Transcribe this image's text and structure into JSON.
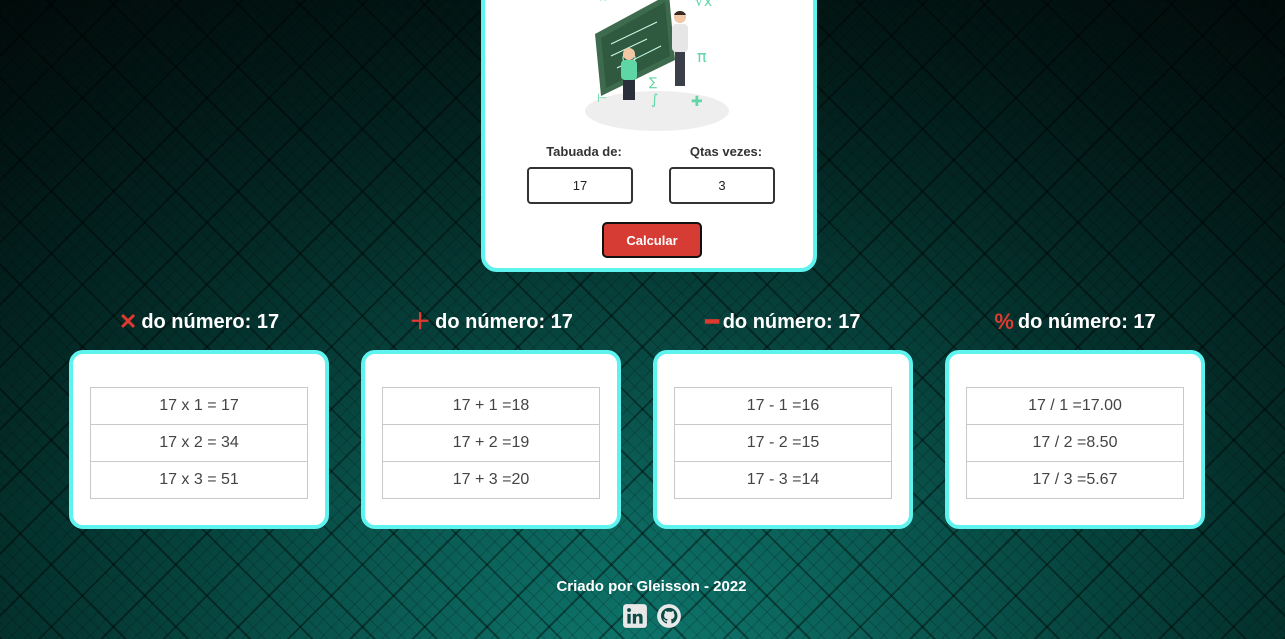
{
  "form": {
    "tabuada_label": "Tabuada de:",
    "vezes_label": "Qtas vezes:",
    "tabuada_value": "17",
    "vezes_value": "3",
    "calc_label": "Calcular"
  },
  "sections": [
    {
      "icon": "times-icon",
      "title": "do número: 17",
      "rows": [
        "17 x 1 = 17",
        "17 x 2 = 34",
        "17 x 3 = 51"
      ]
    },
    {
      "icon": "plus-icon",
      "title": "do número: 17",
      "rows": [
        "17 + 1 =18",
        "17 + 2 =19",
        "17 + 3 =20"
      ]
    },
    {
      "icon": "minus-icon",
      "title": "do número: 17",
      "rows": [
        "17 - 1 =16",
        "17 - 2 =15",
        "17 - 3 =14"
      ]
    },
    {
      "icon": "percent-icon",
      "title": "do número: 17",
      "rows": [
        "17 / 1 =17.00",
        "17 / 2 =8.50",
        "17 / 3 =5.67"
      ]
    }
  ],
  "footer": {
    "credit": "Criado por Gleisson - 2022",
    "links": [
      "linkedin-icon",
      "github-icon"
    ]
  },
  "colors": {
    "accent": "#5ff3ef",
    "button": "#d63c34",
    "icon": "#e03a30"
  }
}
